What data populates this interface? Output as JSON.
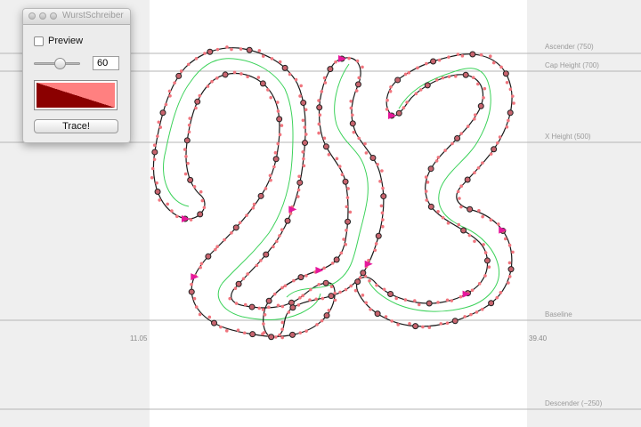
{
  "palette": {
    "title": "WurstSchreiber",
    "preview_label": "Preview",
    "preview_checked": false,
    "slider_value": "60",
    "slider_fraction": 0.6,
    "trace_label": "Trace!",
    "color_dark": "#8b0000",
    "color_light": "#ff8080"
  },
  "metrics": {
    "ascender": "Ascender (750)",
    "cap_height": "Cap Height (700)",
    "x_height": "X Height (500)",
    "baseline": "Baseline",
    "descender": "Descender (−250)"
  },
  "sidebearings": {
    "left": "11.05",
    "right": "39.40"
  },
  "colors": {
    "glyph_area": "#ffffff",
    "background": "#efefef",
    "metric_line": "#b5b5b5",
    "outline": "#1a1a1a",
    "center_line": "#3cd25a",
    "offcurve": "#f0757e",
    "node": "#c8646e",
    "start_marker": "#e6189b"
  }
}
